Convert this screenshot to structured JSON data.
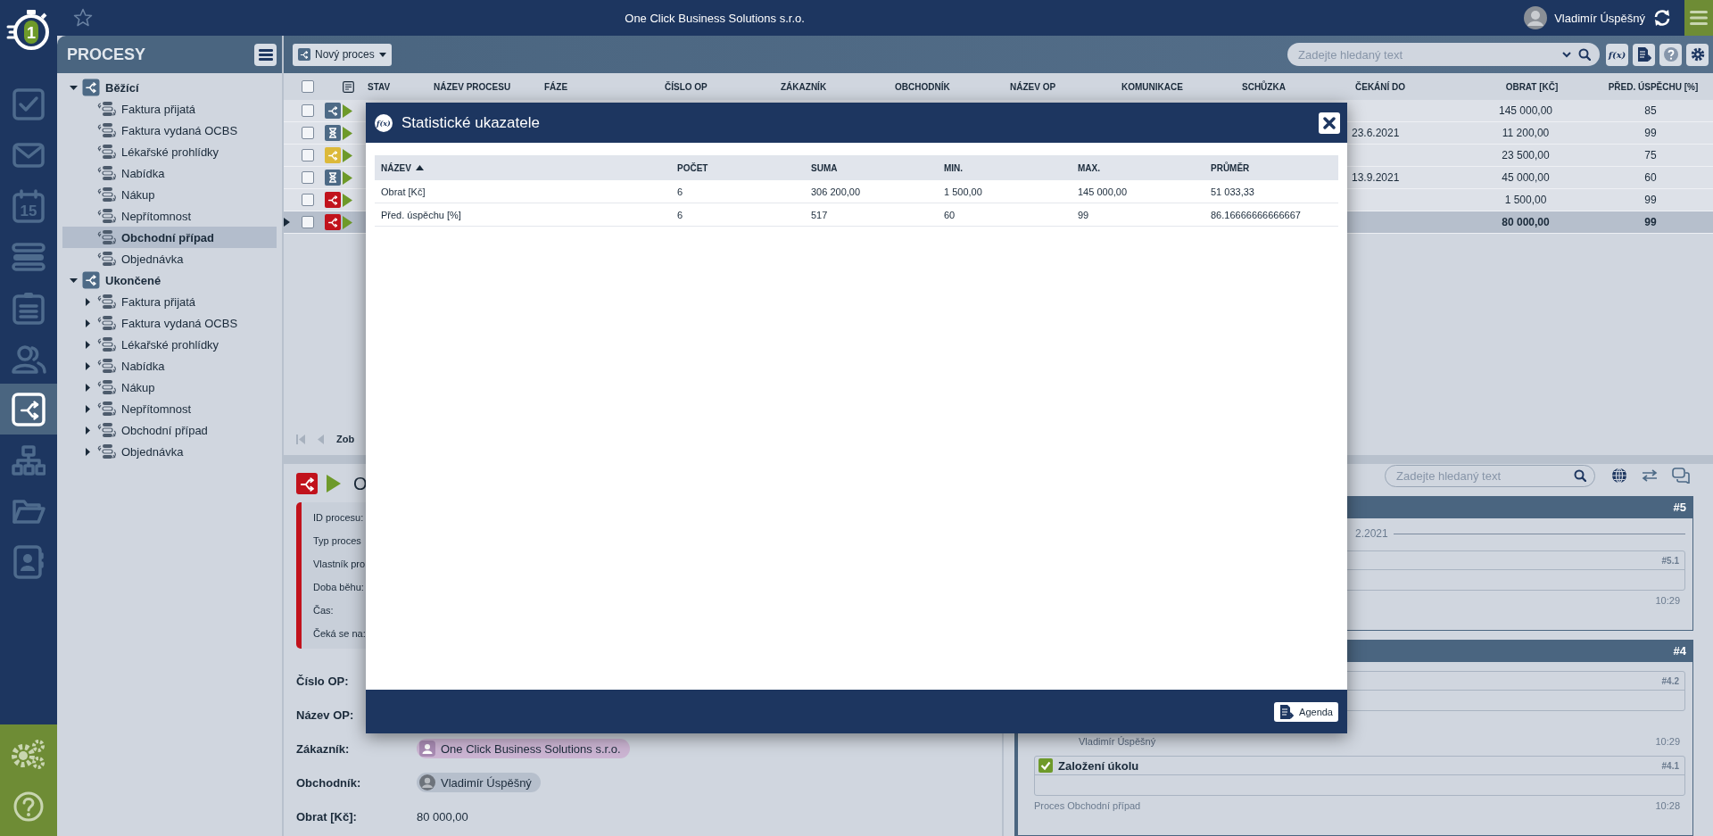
{
  "app": {
    "logo_digit": "1"
  },
  "rail": {
    "items": [
      {
        "kind": "tasks",
        "selected": false
      },
      {
        "kind": "mail",
        "selected": false
      },
      {
        "kind": "calendar",
        "label": "15",
        "selected": false
      },
      {
        "kind": "list",
        "selected": false
      },
      {
        "kind": "clipboard",
        "selected": false
      },
      {
        "kind": "people",
        "selected": false
      },
      {
        "kind": "process",
        "selected": true
      },
      {
        "kind": "org",
        "selected": false
      },
      {
        "kind": "folder",
        "selected": false
      },
      {
        "kind": "contact",
        "selected": false
      }
    ],
    "bottom_items": [
      {
        "kind": "settings"
      },
      {
        "kind": "help"
      }
    ]
  },
  "top_bar": {
    "title": "One Click Business Solutions s.r.o.",
    "user": "Vladimír Úspěšný"
  },
  "processes_panel": {
    "title": "PROCESY",
    "tree": [
      {
        "label": "Běžící",
        "expanded": true,
        "selected": false,
        "children": [
          {
            "label": "Faktura přijatá",
            "selected": false
          },
          {
            "label": "Faktura vydaná OCBS",
            "selected": false
          },
          {
            "label": "Lékařské prohlídky",
            "selected": false
          },
          {
            "label": "Nabídka",
            "selected": false
          },
          {
            "label": "Nákup",
            "selected": false
          },
          {
            "label": "Nepřítomnost",
            "selected": false
          },
          {
            "label": "Obchodní případ",
            "selected": true
          },
          {
            "label": "Objednávka",
            "selected": false
          }
        ]
      },
      {
        "label": "Ukončené",
        "expanded": true,
        "selected": false,
        "children": [
          {
            "label": "Faktura přijatá",
            "expanded": false,
            "selected": false
          },
          {
            "label": "Faktura vydaná OCBS",
            "expanded": false,
            "selected": false
          },
          {
            "label": "Lékařské prohlídky",
            "expanded": false,
            "selected": false
          },
          {
            "label": "Nabídka",
            "expanded": false,
            "selected": false
          },
          {
            "label": "Nákup",
            "expanded": false,
            "selected": false
          },
          {
            "label": "Nepřítomnost",
            "expanded": false,
            "selected": false
          },
          {
            "label": "Obchodní případ",
            "expanded": false,
            "selected": false
          },
          {
            "label": "Objednávka",
            "expanded": false,
            "selected": false
          }
        ]
      }
    ]
  },
  "toolbar": {
    "new_button": "Nový proces",
    "search": {
      "placeholder": "Zadejte hledaný text"
    },
    "buttons": [
      {
        "kind": "stats",
        "label": "f(x)"
      },
      {
        "kind": "export"
      },
      {
        "kind": "help"
      },
      {
        "kind": "settings"
      }
    ]
  },
  "table": {
    "select_all": {
      "checked": false
    },
    "columns": [
      "STAV",
      "NÁZEV PROCESU",
      "FÁZE",
      "ČÍSLO OP",
      "ZÁKAZNÍK",
      "OBCHODNÍK",
      "NÁZEV OP",
      "KOMUNIKACE",
      "SCHŮZKA",
      "ČEKÁNÍ DO",
      "OBRAT [KČ]",
      "PŘED. ÚSPĚCHU [%]"
    ],
    "rows": [
      {
        "kind": "process",
        "color": "#4d6a86",
        "checked": false,
        "selected": false,
        "turnover": "145 000,00",
        "success": "85"
      },
      {
        "kind": "waiting",
        "color": "#4d6a86",
        "checked": false,
        "selected": false,
        "waiting_until": "23.6.2021",
        "turnover": "11 200,00",
        "success": "99"
      },
      {
        "kind": "process",
        "color": "#dcb93a",
        "checked": false,
        "selected": false,
        "turnover": "23 500,00",
        "success": "75"
      },
      {
        "kind": "waiting",
        "color": "#4d6a86",
        "checked": false,
        "selected": false,
        "waiting_until": "13.9.2021",
        "turnover": "45 000,00",
        "success": "60"
      },
      {
        "kind": "process",
        "color": "#c1121c",
        "checked": false,
        "selected": false,
        "turnover": "1 500,00",
        "success": "99"
      },
      {
        "kind": "process",
        "color": "#c1121c",
        "checked": false,
        "selected": true,
        "turnover": "80 000,00",
        "success": "99"
      }
    ]
  },
  "pager": {
    "text": "Zob"
  },
  "modal": {
    "icon_label": "f(x)",
    "title": "Statistické ukazatele",
    "columns": [
      {
        "label": "NÁZEV",
        "sort_ascending": true
      },
      {
        "label": "POČET"
      },
      {
        "label": "SUMA"
      },
      {
        "label": "MIN."
      },
      {
        "label": "MAX."
      },
      {
        "label": "PRŮMĚR"
      }
    ],
    "rows": [
      [
        "Obrat [Kč]",
        "6",
        "306 200,00",
        "1 500,00",
        "145 000,00",
        "51 033,33"
      ],
      [
        "Před. úspěchu [%]",
        "6",
        "517",
        "60",
        "99",
        "86.16666666666667"
      ]
    ],
    "footer_button": "Agenda"
  },
  "detail": {
    "title": "O",
    "info_labels": [
      "ID procesu:",
      "Typ proces",
      "Vlastník pro",
      "Doba běhu:",
      "Čas:",
      "Čeká se na:"
    ],
    "fields": [
      {
        "label": "Číslo OP:"
      },
      {
        "label": "Název OP:"
      },
      {
        "label": "Zákazník:",
        "kind": "company",
        "value": "One Click Business Solutions s.r.o."
      },
      {
        "label": "Obchodník:",
        "kind": "person",
        "value": "Vladimír Úspěšný"
      },
      {
        "label": "Obrat [Kč]:",
        "kind": "text",
        "value": "80 000,00"
      }
    ]
  },
  "timeline": {
    "search": {
      "placeholder": "Zadejte hledaný text"
    },
    "groups": [
      {
        "number": "#5",
        "date": "2.2021",
        "cards": [
          {
            "number": "#5.1",
            "time": "10:29"
          }
        ]
      },
      {
        "number": "#4",
        "cards": [
          {
            "number": "#4.2",
            "author": "Vladimír Úspěšný",
            "time": "10:29"
          },
          {
            "number": "#4.1",
            "title": "Založení úkolu",
            "checked": true,
            "subtitle": "Proces Obchodní případ",
            "time": "10:28"
          }
        ]
      }
    ]
  }
}
